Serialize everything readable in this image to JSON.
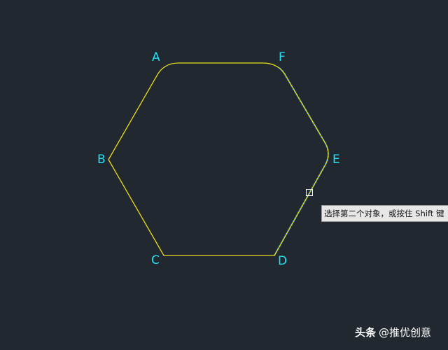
{
  "vertices": {
    "a": "A",
    "b": "B",
    "c": "C",
    "d": "D",
    "e": "E",
    "f": "F"
  },
  "tooltip": {
    "prompt": "选择第二个对象，或按住 Shift 键"
  },
  "watermark": {
    "brand": "头条",
    "handle": "@推优创意"
  },
  "colors": {
    "background": "#212830",
    "hexagon_outline": "#e8de1a",
    "selected_edge_highlight": "#3f8fd0",
    "vertex_label": "#22e0f0",
    "pickbox": "#ffffff",
    "tooltip_background": "#e7e7e7"
  },
  "icons": {
    "cursor": "pickbox-cursor-icon"
  }
}
